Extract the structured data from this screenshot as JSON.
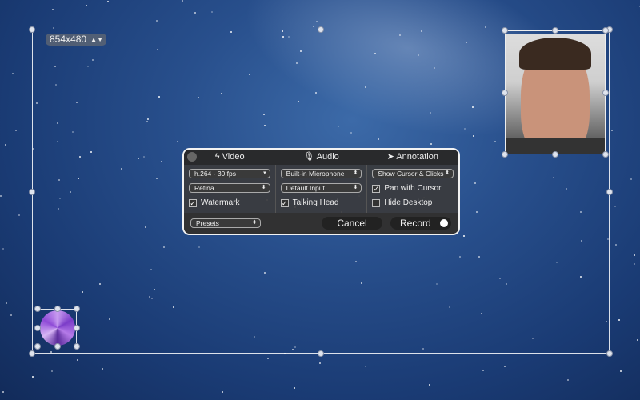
{
  "resolution": {
    "value": "854x480"
  },
  "panel": {
    "tabs": [
      {
        "label": "Video",
        "icon": "lightning-icon"
      },
      {
        "label": "Audio",
        "icon": "microphone-icon"
      },
      {
        "label": "Annotation",
        "icon": "cursor-icon"
      }
    ],
    "video": {
      "codec": "h.264 - 30 fps",
      "quality": "Retina",
      "watermark_label": "Watermark",
      "watermark_checked": true
    },
    "audio": {
      "input": "Built-in Microphone",
      "channel": "Default Input",
      "talking_head_label": "Talking Head",
      "talking_head_checked": true
    },
    "annotation": {
      "cursor": "Show Cursor & Clicks",
      "pan_label": "Pan with Cursor",
      "pan_checked": true,
      "hide_desktop_label": "Hide Desktop",
      "hide_desktop_checked": false
    },
    "presets": "Presets",
    "cancel": "Cancel",
    "record": "Record"
  }
}
